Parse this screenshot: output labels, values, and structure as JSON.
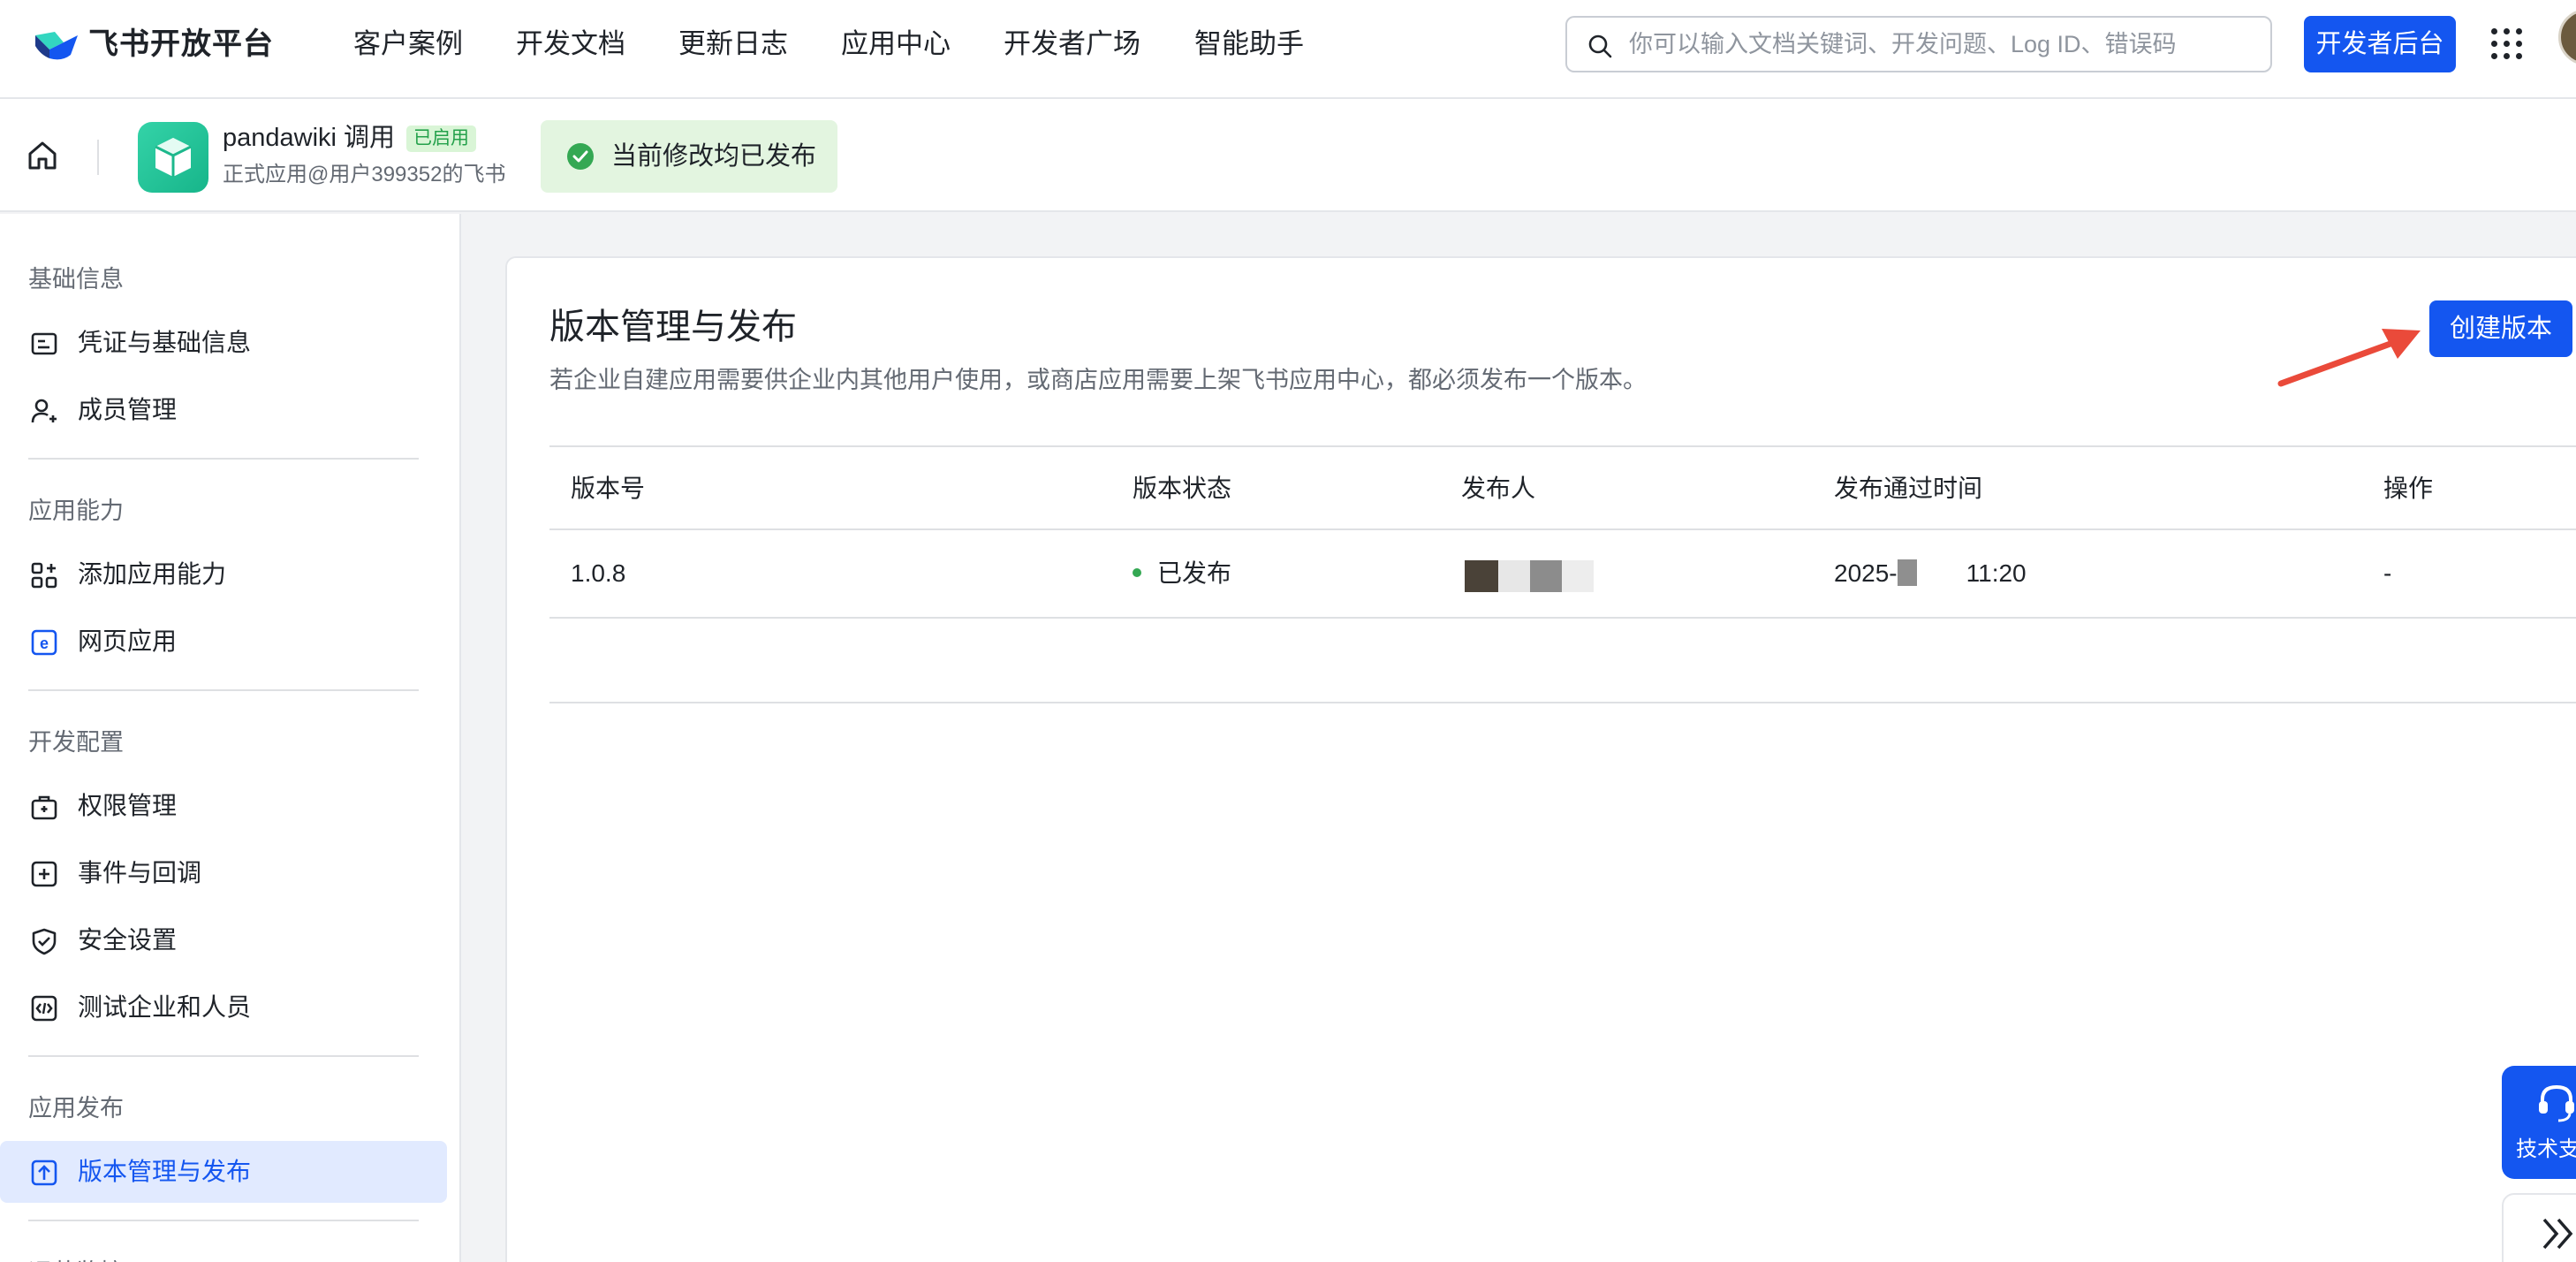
{
  "topnav": {
    "logo_text": "飞书开放平台",
    "items": [
      {
        "label": "客户案例"
      },
      {
        "label": "开发文档"
      },
      {
        "label": "更新日志"
      },
      {
        "label": "应用中心"
      },
      {
        "label": "开发者广场"
      },
      {
        "label": "智能助手"
      }
    ],
    "search_placeholder": "你可以输入文档关键词、开发问题、Log ID、错误码",
    "dev_console_label": "开发者后台"
  },
  "appbar": {
    "app_name": "pandawiki 调用",
    "app_badge": "已启用",
    "app_subtitle": "正式应用@用户399352的飞书",
    "publish_status": "当前修改均已发布"
  },
  "sidebar": {
    "groups": [
      {
        "title": "基础信息",
        "items": [
          {
            "label": "凭证与基础信息",
            "icon": "credential-icon"
          },
          {
            "label": "成员管理",
            "icon": "member-add-icon"
          }
        ]
      },
      {
        "title": "应用能力",
        "items": [
          {
            "label": "添加应用能力",
            "icon": "add-capability-icon"
          },
          {
            "label": "网页应用",
            "icon": "web-app-icon"
          }
        ]
      },
      {
        "title": "开发配置",
        "items": [
          {
            "label": "权限管理",
            "icon": "permission-icon"
          },
          {
            "label": "事件与回调",
            "icon": "event-callback-icon"
          },
          {
            "label": "安全设置",
            "icon": "shield-icon"
          },
          {
            "label": "测试企业和人员",
            "icon": "test-code-icon"
          }
        ]
      },
      {
        "title": "应用发布",
        "items": [
          {
            "label": "版本管理与发布",
            "icon": "upload-icon",
            "active": true
          }
        ]
      },
      {
        "title": "运营监控",
        "items": []
      }
    ]
  },
  "main": {
    "title": "版本管理与发布",
    "description": "若企业自建应用需要供企业内其他用户使用，或商店应用需要上架飞书应用中心，都必须发布一个版本。",
    "create_button": "创建版本",
    "table": {
      "headers": [
        "版本号",
        "版本状态",
        "发布人",
        "发布通过时间",
        "操作"
      ],
      "rows": [
        {
          "version": "1.0.8",
          "status": "已发布",
          "publisher": "",
          "time_prefix": "2025-",
          "time_suffix": "11:20",
          "action": "-"
        }
      ]
    }
  },
  "support": {
    "label": "技术支"
  },
  "colors": {
    "brand": "#1456f0",
    "success": "#34a853",
    "annotation_arrow": "#ea4a3a"
  }
}
